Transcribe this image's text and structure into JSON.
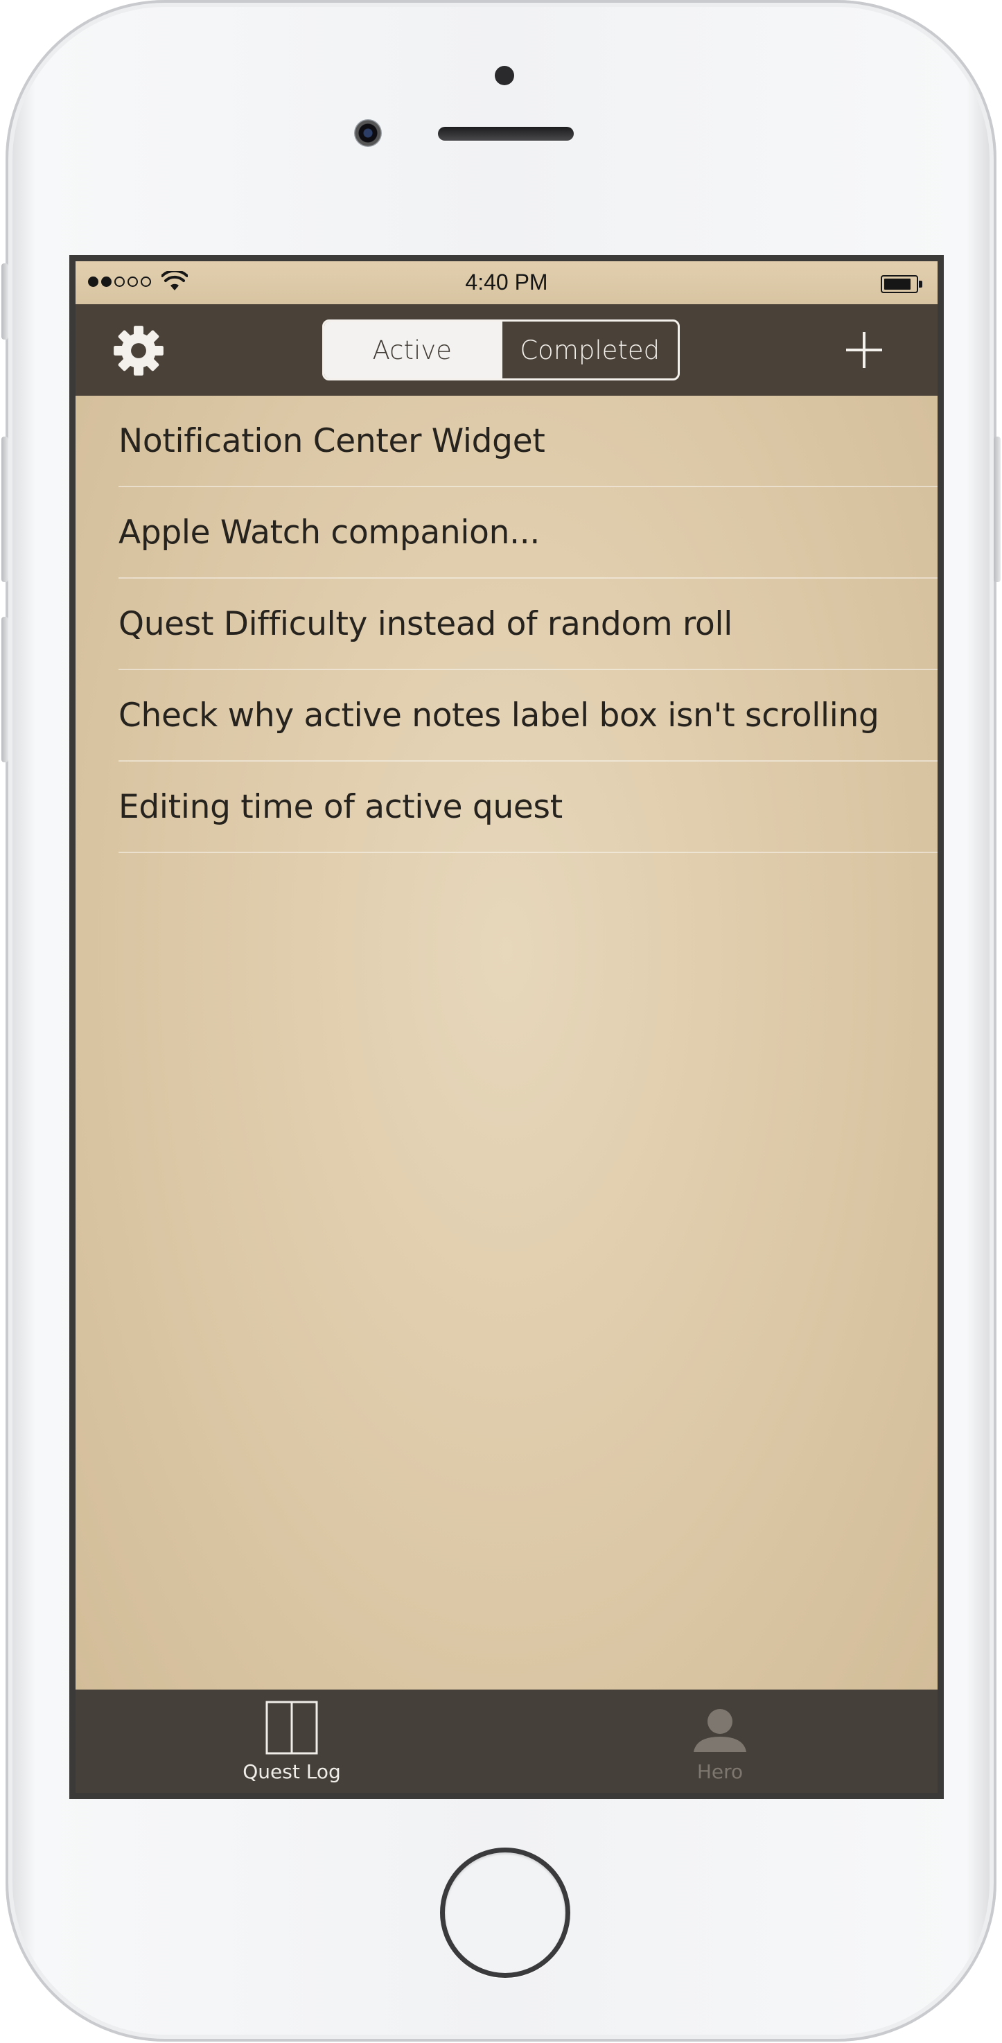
{
  "status_bar": {
    "time": "4:40 PM",
    "signal_bars_filled": 2,
    "signal_bars_total": 5,
    "wifi_icon": "wifi-icon",
    "battery_icon": "battery-icon"
  },
  "nav_bar": {
    "settings_icon": "gear-icon",
    "segments": [
      {
        "label": "Active",
        "selected": true
      },
      {
        "label": "Completed",
        "selected": false
      }
    ],
    "add_icon": "plus-icon"
  },
  "quests": [
    {
      "title": "Notification Center Widget"
    },
    {
      "title": "Apple Watch companion..."
    },
    {
      "title": "Quest Difficulty instead of random roll"
    },
    {
      "title": "Check why active notes label box isn't scrolling"
    },
    {
      "title": "Editing time of active quest"
    }
  ],
  "tab_bar": {
    "tabs": [
      {
        "label": "Quest Log",
        "icon": "book-icon",
        "active": true
      },
      {
        "label": "Hero",
        "icon": "person-icon",
        "active": false
      }
    ]
  },
  "colors": {
    "nav_background": "#4a4239",
    "tab_background": "#45403a",
    "parchment": "#dcc8a6",
    "text": "#26221d"
  }
}
